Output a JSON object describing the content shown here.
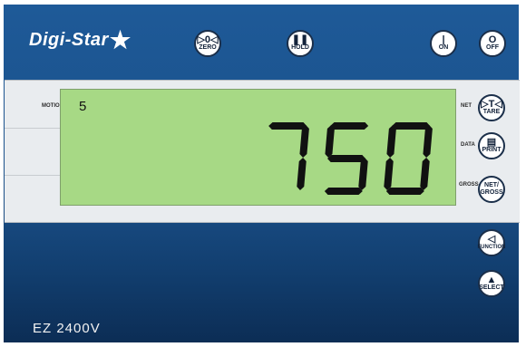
{
  "brand": {
    "name": "Digi-Star",
    "star": "★"
  },
  "top_buttons": [
    {
      "symbol": "▷0◁",
      "label": "ZERO"
    },
    {
      "symbol": "❚❚",
      "label": "HOLD"
    },
    {
      "symbol": "|",
      "label": "ON"
    },
    {
      "symbol": "O",
      "label": "OFF"
    }
  ],
  "side_buttons": [
    {
      "symbol": "▷T◁",
      "label": "TARE"
    },
    {
      "symbol": "▤",
      "label": "PRINT"
    },
    {
      "symbol": "NET/",
      "label": "GROSS"
    },
    {
      "symbol": "◁",
      "label": "FUNCTION"
    },
    {
      "symbol": "▲",
      "label": "SELECT"
    }
  ],
  "indicators": {
    "motion": "MOTION",
    "net": "NET",
    "data": "DATA",
    "gross": "GROSS"
  },
  "display": {
    "small_value": "5",
    "weight": "750",
    "segment_color": "#111111"
  },
  "model": "EZ 2400V",
  "colors": {
    "body": "#1a4f88",
    "lcd": "#a7d985"
  }
}
